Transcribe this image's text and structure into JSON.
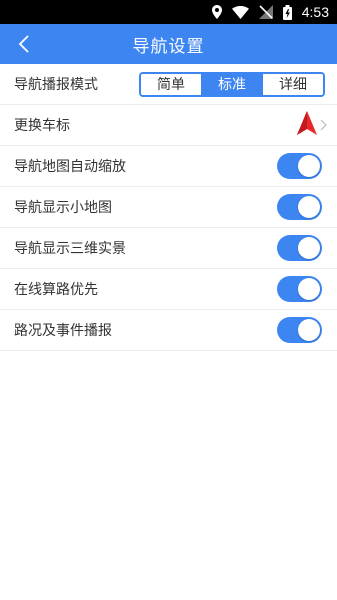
{
  "status_bar": {
    "time": "4:53",
    "icons": [
      "location-icon",
      "wifi-icon",
      "no-signal-icon",
      "battery-icon"
    ]
  },
  "header": {
    "title": "导航设置",
    "back_icon": "chevron-left-icon"
  },
  "colors": {
    "accent": "#3d86f2",
    "car_icon": "#e8282b"
  },
  "broadcast_mode": {
    "label": "导航播报模式",
    "options": [
      "简单",
      "标准",
      "详细"
    ],
    "selected": "标准"
  },
  "car_icon_row": {
    "label": "更换车标",
    "icon": "navigation-arrow-icon"
  },
  "toggles": [
    {
      "label": "导航地图自动缩放",
      "on": true
    },
    {
      "label": "导航显示小地图",
      "on": true
    },
    {
      "label": "导航显示三维实景",
      "on": true
    },
    {
      "label": "在线算路优先",
      "on": true
    },
    {
      "label": "路况及事件播报",
      "on": true
    }
  ]
}
